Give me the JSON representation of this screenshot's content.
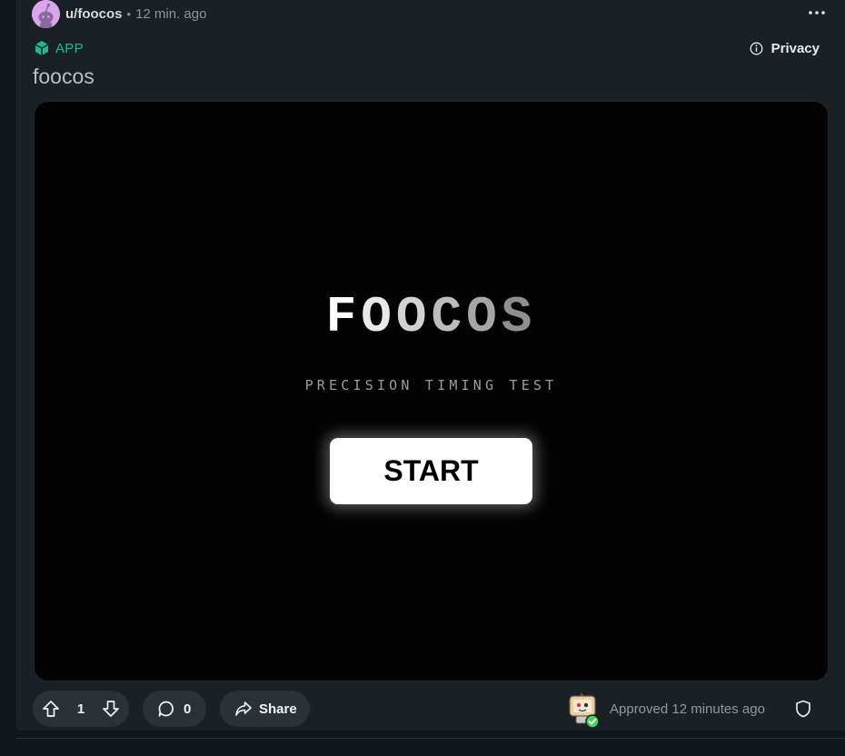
{
  "post": {
    "username": "u/foocos",
    "separator": "•",
    "time": "12 min. ago",
    "badge_label": "APP",
    "privacy_label": "Privacy",
    "title": "foocos"
  },
  "game": {
    "title_letters": [
      "F",
      "O",
      "O",
      "C",
      "O",
      "S"
    ],
    "title_colors": [
      "#ffffff",
      "#e9e9e9",
      "#d2d2d2",
      "#bcbcbc",
      "#a6a6a6",
      "#8f8f8f"
    ],
    "subtitle": "PRECISION TIMING TEST",
    "start_label": "START"
  },
  "actions": {
    "vote_count": "1",
    "comment_count": "0",
    "share_label": "Share",
    "approved_text": "Approved 12 minutes ago"
  },
  "colors": {
    "accent_app": "#1db992",
    "approved_check": "#46d160"
  }
}
